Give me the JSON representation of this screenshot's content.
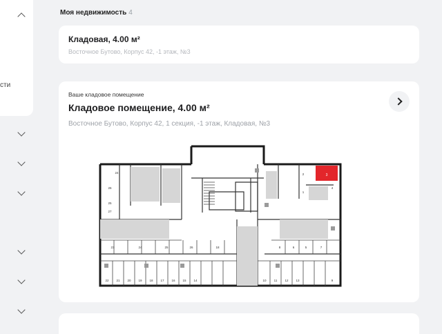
{
  "sidebar": {
    "text_fragment": "сти"
  },
  "section": {
    "title": "Моя недвижимость",
    "count": "4"
  },
  "property_card": {
    "title": "Кладовая, 4.00 м²",
    "address": "Восточное Бутово, Корпус 42, -1 этаж, №3"
  },
  "storage_card": {
    "eyebrow": "Ваше кладовое помещение",
    "title": "Кладовое помещение, 4.00 м²",
    "address": "Восточное Бутово, Корпус 42, 1 секция, -1 этаж, Кладовая, №3"
  },
  "floor_plan": {
    "highlight_color": "#e3262b",
    "highlight_label": "3",
    "room_labels": [
      "24",
      "26",
      "25",
      "27",
      "23",
      "24",
      "25",
      "26",
      "18",
      "8",
      "6",
      "5",
      "7",
      "22",
      "21",
      "20",
      "19",
      "18",
      "17",
      "16",
      "15",
      "14",
      "10",
      "11",
      "12",
      "13",
      "9",
      "2",
      "1",
      "4"
    ]
  }
}
